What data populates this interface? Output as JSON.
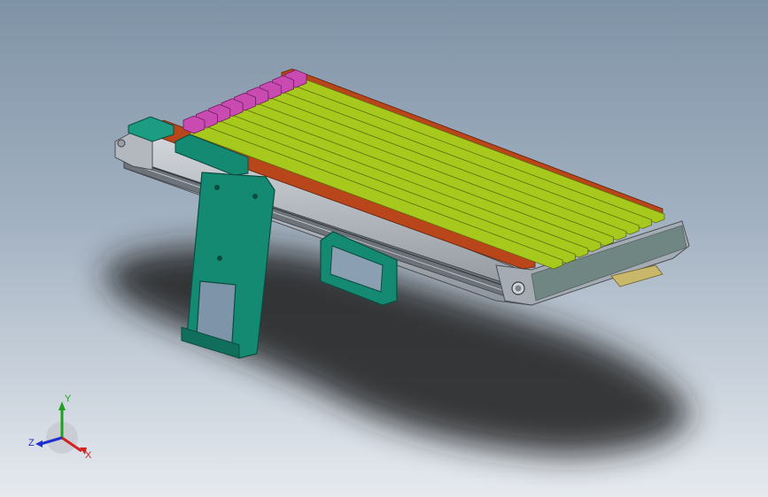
{
  "viewport": {
    "background_top": "#7f93a6",
    "background_bottom": "#e6eaef"
  },
  "model": {
    "colors": {
      "shelf_green": "#a7c81c",
      "rail_orange": "#b9461a",
      "bracket_teal": "#148a73",
      "clamp_magenta": "#c94ab0",
      "frame_grey": "#b7bcc2",
      "shadow": "#1b1b1b"
    },
    "bar_count": 9
  },
  "triad": {
    "x_label": "X",
    "y_label": "Y",
    "z_label": "Z",
    "x_color": "#d52020",
    "y_color": "#20a020",
    "z_color": "#2030d0"
  }
}
